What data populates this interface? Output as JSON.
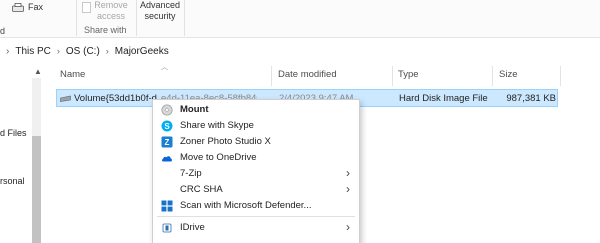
{
  "ribbon": {
    "fax_label": "Fax",
    "left_edge_label": "d",
    "remove_access_label": "Remove access",
    "share_group_label": "Share with",
    "advanced_security_label": "Advanced security"
  },
  "address": {
    "crumbs": [
      "This PC",
      "OS (C:)",
      "MajorGeeks"
    ]
  },
  "nav": {
    "items": [
      "d Files",
      "rsonal"
    ]
  },
  "columns": {
    "name": "Name",
    "date_modified": "Date modified",
    "type": "Type",
    "size": "Size"
  },
  "file": {
    "name": "Volume{53dd1b0f-d",
    "name_obscured": "e4d-11ea-8ec8-58fb840efb",
    "date": "2/4/2023 9:47 AM",
    "type": "Hard Disk Image File",
    "size": "987,381 KB"
  },
  "context_menu": {
    "items": [
      {
        "label": "Mount",
        "icon": "disc-icon"
      },
      {
        "label": "Share with Skype",
        "icon": "skype-icon"
      },
      {
        "label": "Zoner Photo Studio X",
        "icon": "zoner-icon"
      },
      {
        "label": "Move to OneDrive",
        "icon": "onedrive-icon"
      },
      {
        "label": "7-Zip",
        "icon": "",
        "submenu": true
      },
      {
        "label": "CRC SHA",
        "icon": "",
        "submenu": true
      },
      {
        "label": "Scan with Microsoft Defender...",
        "icon": "defender-icon"
      },
      {
        "label": "IDrive",
        "icon": "idrive-icon",
        "submenu": true
      }
    ]
  },
  "colors": {
    "selection_bg": "#cce8ff",
    "selection_border": "#99d1ff",
    "skype": "#00aff0",
    "zoner": "#1a7fd0",
    "onedrive": "#0a64d8",
    "defender": "#1a73c9"
  }
}
